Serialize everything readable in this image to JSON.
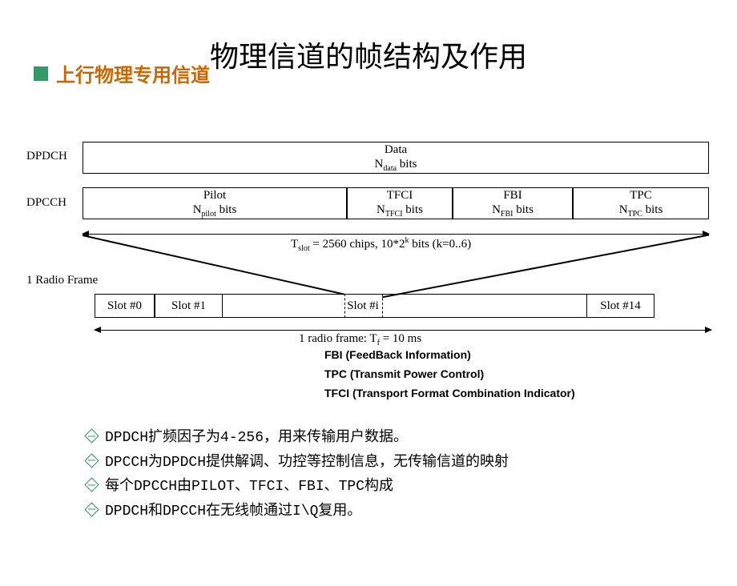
{
  "title": "物理信道的帧结构及作用",
  "subtitle": "上行物理专用信道",
  "diagram": {
    "dpdch_label": "DPDCH",
    "dpdch_line1": "Data",
    "dpdch_line2_a": "N",
    "dpdch_line2_sub": "data",
    "dpdch_line2_b": " bits",
    "dpcch_label": "DPCCH",
    "cells": [
      {
        "title": "Pilot",
        "sub": "pilot"
      },
      {
        "title": "TFCI",
        "sub": "TFCI"
      },
      {
        "title": "FBI",
        "sub": "FBI"
      },
      {
        "title": "TPC",
        "sub": "TPC"
      }
    ],
    "tslot_a": "T",
    "tslot_sub": "slot",
    "tslot_b": " = 2560 chips, 10*2",
    "tslot_sup": "k",
    "tslot_c": " bits (k=0..6)",
    "frame_label": "1 Radio Frame",
    "slot0": "Slot #0",
    "slot1": "Slot #1",
    "sloti": "Slot #i",
    "slot14": "Slot #14",
    "frame_text_a": "1 radio frame: T",
    "frame_text_sub": "f",
    "frame_text_b": " = 10 ms"
  },
  "legend": {
    "l1": "FBI (FeedBack Information)",
    "l2": "TPC (Transmit Power Control)",
    "l3": "TFCI (Transport Format Combination Indicator)"
  },
  "notes": [
    "DPDCH扩频因子为4-256，用来传输用户数据。",
    "DPCCH为DPDCH提供解调、功控等控制信息，无传输信道的映射",
    "每个DPCCH由PILOT、TFCI、FBI、TPC构成",
    "DPDCH和DPCCH在无线帧通过I\\Q复用。"
  ]
}
